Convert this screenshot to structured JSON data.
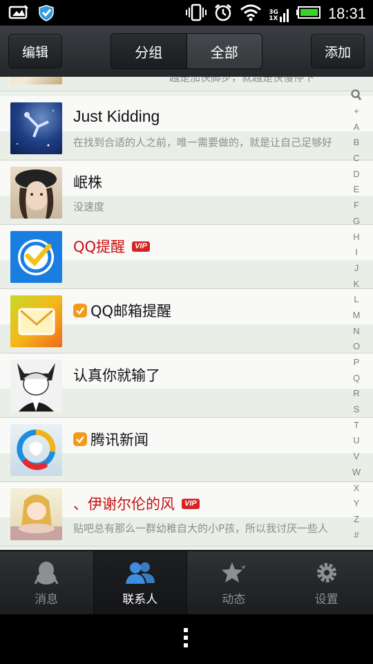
{
  "status_bar": {
    "time": "18:31",
    "network_top": "3G",
    "network_bottom": "1X",
    "icons": [
      "picture-icon",
      "shield-icon",
      "vibrate-icon",
      "alarm-icon",
      "wifi-icon",
      "signal-icon",
      "battery-icon"
    ]
  },
  "header": {
    "edit_label": "编辑",
    "add_label": "添加",
    "segments": [
      "分组",
      "全部"
    ],
    "active_segment": "全部"
  },
  "partial_row": {
    "signature": "越是加快脚步，就越是快慢停下"
  },
  "contacts": [
    {
      "name": "Just Kidding",
      "signature": "在找到合适的人之前，唯一需要做的，就是让自己足够好",
      "vip": false,
      "verified": false,
      "red": false
    },
    {
      "name": "岷株",
      "signature": "没速度",
      "vip": false,
      "verified": false,
      "red": false
    },
    {
      "name": "QQ提醒",
      "signature": "",
      "vip": true,
      "verified": false,
      "red": true
    },
    {
      "name": "QQ邮箱提醒",
      "signature": "",
      "vip": false,
      "verified": true,
      "red": false
    },
    {
      "name": "认真你就输了",
      "signature": "",
      "vip": false,
      "verified": false,
      "red": false
    },
    {
      "name": "腾讯新闻",
      "signature": "",
      "vip": false,
      "verified": true,
      "red": false
    },
    {
      "name": "、伊谢尔伦的风",
      "signature": "贴吧总有那么一群幼稚自大的小P孩，所以我讨厌一些人",
      "vip": true,
      "verified": false,
      "red": true
    }
  ],
  "vip_label": "VIP",
  "index_letters": [
    "+",
    "A",
    "B",
    "C",
    "D",
    "E",
    "F",
    "G",
    "H",
    "I",
    "J",
    "K",
    "L",
    "M",
    "N",
    "O",
    "P",
    "Q",
    "R",
    "S",
    "T",
    "U",
    "V",
    "W",
    "X",
    "Y",
    "Z",
    "#"
  ],
  "tabs": [
    {
      "label": "消息",
      "icon": "penguin-icon",
      "active": false
    },
    {
      "label": "联系人",
      "icon": "contacts-icon",
      "active": true
    },
    {
      "label": "动态",
      "icon": "star-icon",
      "active": false
    },
    {
      "label": "设置",
      "icon": "gear-icon",
      "active": false
    }
  ],
  "colors": {
    "accent_red": "#c70e0e",
    "vip_badge": "#d42424",
    "verified_badge": "#f29b1a",
    "active_tab_icon": "#3f8de0"
  }
}
